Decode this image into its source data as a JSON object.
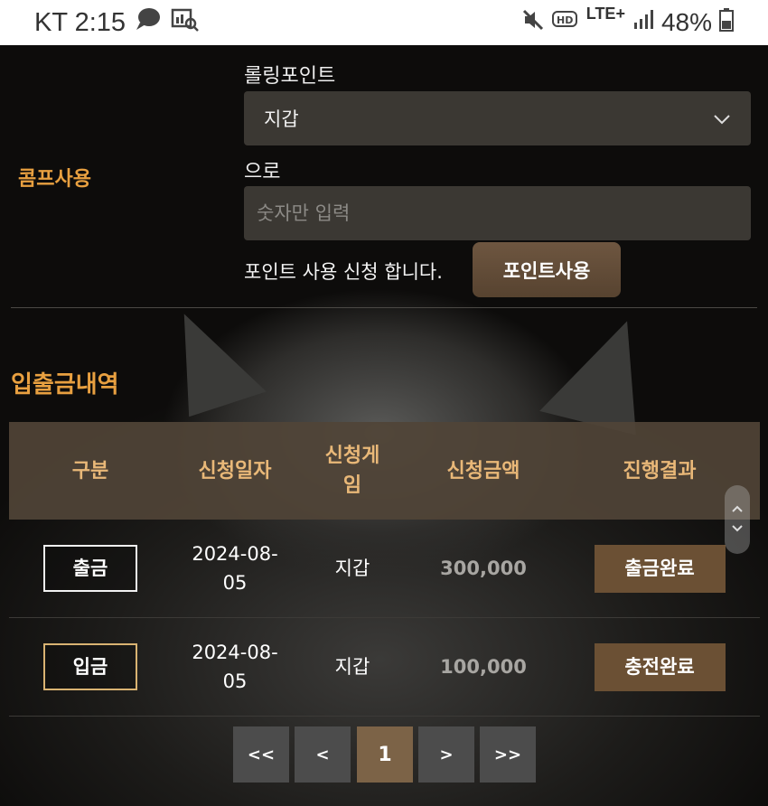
{
  "status_bar": {
    "carrier_time": "KT 2:15",
    "network": "LTE+",
    "battery": "48%",
    "icons": [
      "chat-bubble-icon",
      "chart-search-icon",
      "mute-icon",
      "hd-voice-icon",
      "signal-icon",
      "battery-icon"
    ]
  },
  "comp": {
    "label": "콤프사용",
    "rolling_caption": "롤링포인트",
    "select_value": "지갑",
    "to_caption": "으로",
    "amount_placeholder": "숫자만 입력",
    "apply_text": "포인트 사용 신청 합니다.",
    "apply_button": "포인트사용"
  },
  "history": {
    "title": "입출금내역",
    "columns": [
      "구분",
      "신청일자",
      "신청게임",
      "신청금액",
      "진행결과"
    ],
    "rows": [
      {
        "type": "출금",
        "date": "2024-08-05",
        "game": "지갑",
        "amount": "300,000",
        "result": "출금완료"
      },
      {
        "type": "입금",
        "date": "2024-08-05",
        "game": "지갑",
        "amount": "100,000",
        "result": "충전완료"
      }
    ]
  },
  "pagination": {
    "first": "<<",
    "prev": "<",
    "current": "1",
    "next": ">",
    "last": ">>"
  },
  "colors": {
    "accent": "#e8a040",
    "button": "#6b5034",
    "header_bg": "#504437",
    "header_text": "#e9b878"
  }
}
